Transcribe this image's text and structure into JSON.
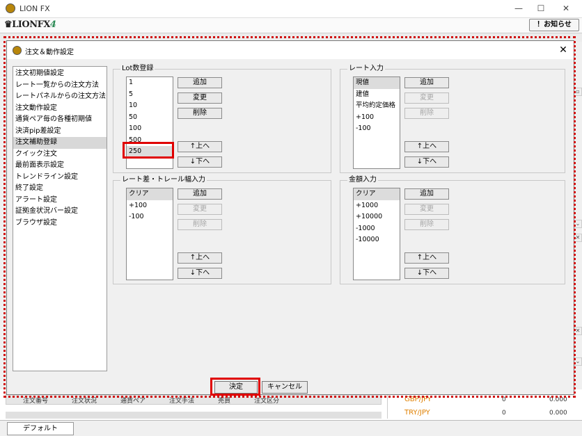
{
  "app": {
    "title": "LION FX",
    "brand_text": "LIONFX",
    "brand_version": "4",
    "notice_button": "！お知らせ",
    "minimize": "—",
    "maximize": "☐",
    "close": "✕"
  },
  "background": {
    "table_headers": [
      "注文番号",
      "注文状況",
      "通貨ペア",
      "注文手法",
      "売買",
      "注文区分"
    ],
    "right_rows": [
      {
        "pair": "GBP/JPY",
        "count": "0",
        "value": "0.000"
      },
      {
        "pair": "TRY/JPY",
        "count": "0",
        "value": "0.000"
      }
    ],
    "status_tab": "デフォルト"
  },
  "dialog": {
    "title": "注文＆動作設定",
    "close": "✕",
    "nav_items": [
      "注文初期値設定",
      "レート一覧からの注文方法",
      "レートパネルからの注文方法",
      "注文動作設定",
      "通貨ペア毎の各種初期値",
      "決済pip差設定",
      "注文補助登録",
      "クイック注文",
      "最前面表示設定",
      "トレンドライン設定",
      "終了設定",
      "アラート設定",
      "証拠金状況バー設定",
      "ブラウザ設定"
    ],
    "selected_nav": 6,
    "lot_group": {
      "label": "Lot数登録",
      "items": [
        "1",
        "5",
        "10",
        "50",
        "100",
        "500",
        "250"
      ],
      "selected": 6,
      "buttons": {
        "add": "追加",
        "change": "変更",
        "delete": "削除",
        "up": "↑上へ",
        "down": "↓下へ"
      }
    },
    "rate_group": {
      "label": "レート入力",
      "items": [
        "現値",
        "建値",
        "平均約定価格",
        "+100",
        "-100"
      ],
      "selected": 0,
      "buttons": {
        "add": "追加",
        "change": "変更",
        "delete": "削除",
        "up": "↑上へ",
        "down": "↓下へ"
      }
    },
    "trail_group": {
      "label": "レート差・トレール幅入力",
      "items": [
        "クリア",
        "+100",
        "-100"
      ],
      "selected": 0,
      "buttons": {
        "add": "追加",
        "change": "変更",
        "delete": "削除",
        "up": "↑上へ",
        "down": "↓下へ"
      }
    },
    "amount_group": {
      "label": "金額入力",
      "items": [
        "クリア",
        "+1000",
        "+10000",
        "-1000",
        "-10000"
      ],
      "selected": 0,
      "buttons": {
        "add": "追加",
        "change": "変更",
        "delete": "削除",
        "up": "↑上へ",
        "down": "↓下へ"
      }
    },
    "ok_button": "決定",
    "cancel_button": "キャンセル"
  },
  "colors": {
    "highlight": "#e00000",
    "dotted_outline": "#d01010",
    "selected_bg": "#dcdcdc",
    "disabled_text": "#a6a6a6"
  }
}
